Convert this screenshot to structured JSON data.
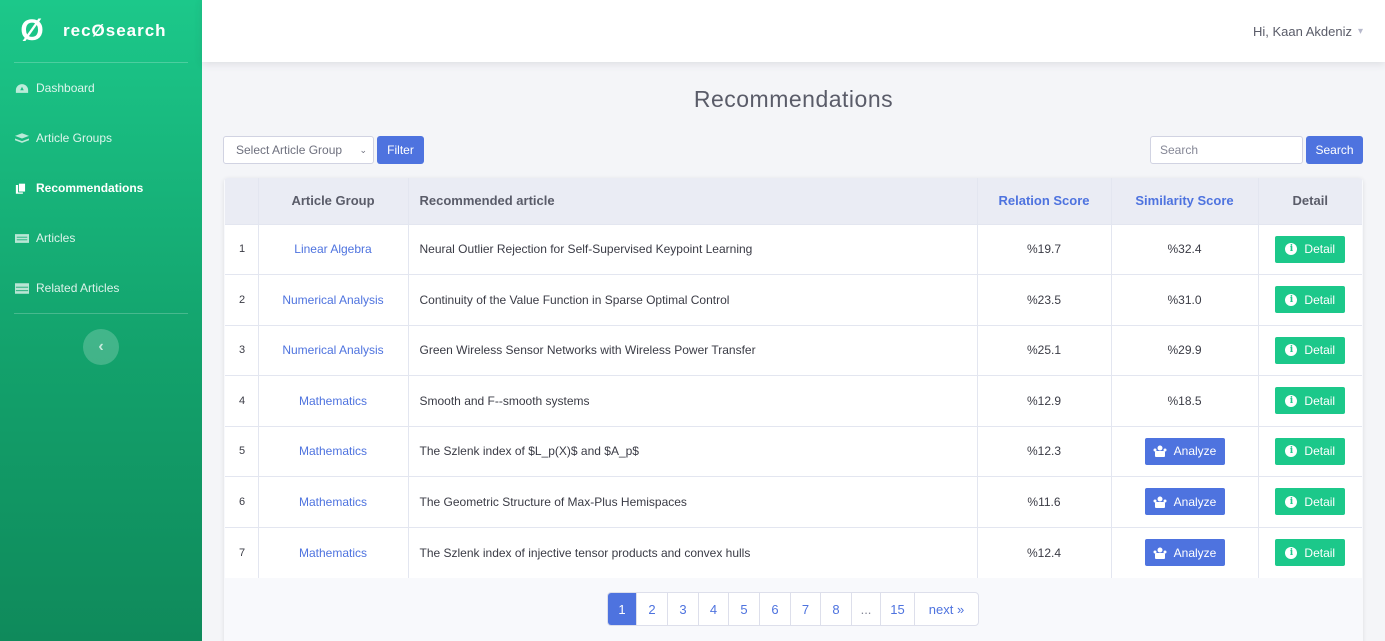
{
  "brand": {
    "logo": "Ø",
    "name": "recØsearch"
  },
  "sidebar": {
    "items": [
      {
        "label": "Dashboard",
        "icon": "dashboard-icon"
      },
      {
        "label": "Article Groups",
        "icon": "layers-icon"
      },
      {
        "label": "Recommendations",
        "icon": "copy-icon",
        "active": true
      },
      {
        "label": "Articles",
        "icon": "list-icon"
      },
      {
        "label": "Related Articles",
        "icon": "table-icon"
      }
    ],
    "collapse_glyph": "‹"
  },
  "topbar": {
    "greeting": "Hi, Kaan Akdeniz",
    "caret": "▾"
  },
  "page": {
    "title": "Recommendations"
  },
  "toolbar": {
    "select_value": "Select Article Group",
    "filter_label": "Filter",
    "search_placeholder": "Search",
    "search_label": "Search"
  },
  "table": {
    "headers": {
      "index": "",
      "group": "Article Group",
      "article": "Recommended article",
      "relation": "Relation Score",
      "similarity": "Similarity Score",
      "detail": "Detail"
    },
    "detail_label": "Detail",
    "analyze_label": "Analyze",
    "rows": [
      {
        "n": "1",
        "group": "Linear Algebra",
        "title": "Neural Outlier Rejection for Self-Supervised Keypoint Learning",
        "relation": "%19.7",
        "similarity": "%32.4"
      },
      {
        "n": "2",
        "group": "Numerical Analysis",
        "title": "Continuity of the Value Function in Sparse Optimal Control",
        "relation": "%23.5",
        "similarity": "%31.0"
      },
      {
        "n": "3",
        "group": "Numerical Analysis",
        "title": "Green Wireless Sensor Networks with Wireless Power Transfer",
        "relation": "%25.1",
        "similarity": "%29.9"
      },
      {
        "n": "4",
        "group": "Mathematics",
        "title": "Smooth and F--smooth systems",
        "relation": "%12.9",
        "similarity": "%18.5"
      },
      {
        "n": "5",
        "group": "Mathematics",
        "title": "The Szlenk index of $L_p(X)$ and $A_p$",
        "relation": "%12.3",
        "similarity": ""
      },
      {
        "n": "6",
        "group": "Mathematics",
        "title": "The Geometric Structure of Max-Plus Hemispaces",
        "relation": "%11.6",
        "similarity": ""
      },
      {
        "n": "7",
        "group": "Mathematics",
        "title": "The Szlenk index of injective tensor products and convex hulls",
        "relation": "%12.4",
        "similarity": ""
      }
    ]
  },
  "pagination": {
    "pages": [
      "1",
      "2",
      "3",
      "4",
      "5",
      "6",
      "7",
      "8",
      "...",
      "15",
      "next »"
    ],
    "active": "1"
  },
  "colors": {
    "primary": "#4e73df",
    "success": "#1cc88a",
    "sidebar": "#1cc88a"
  }
}
